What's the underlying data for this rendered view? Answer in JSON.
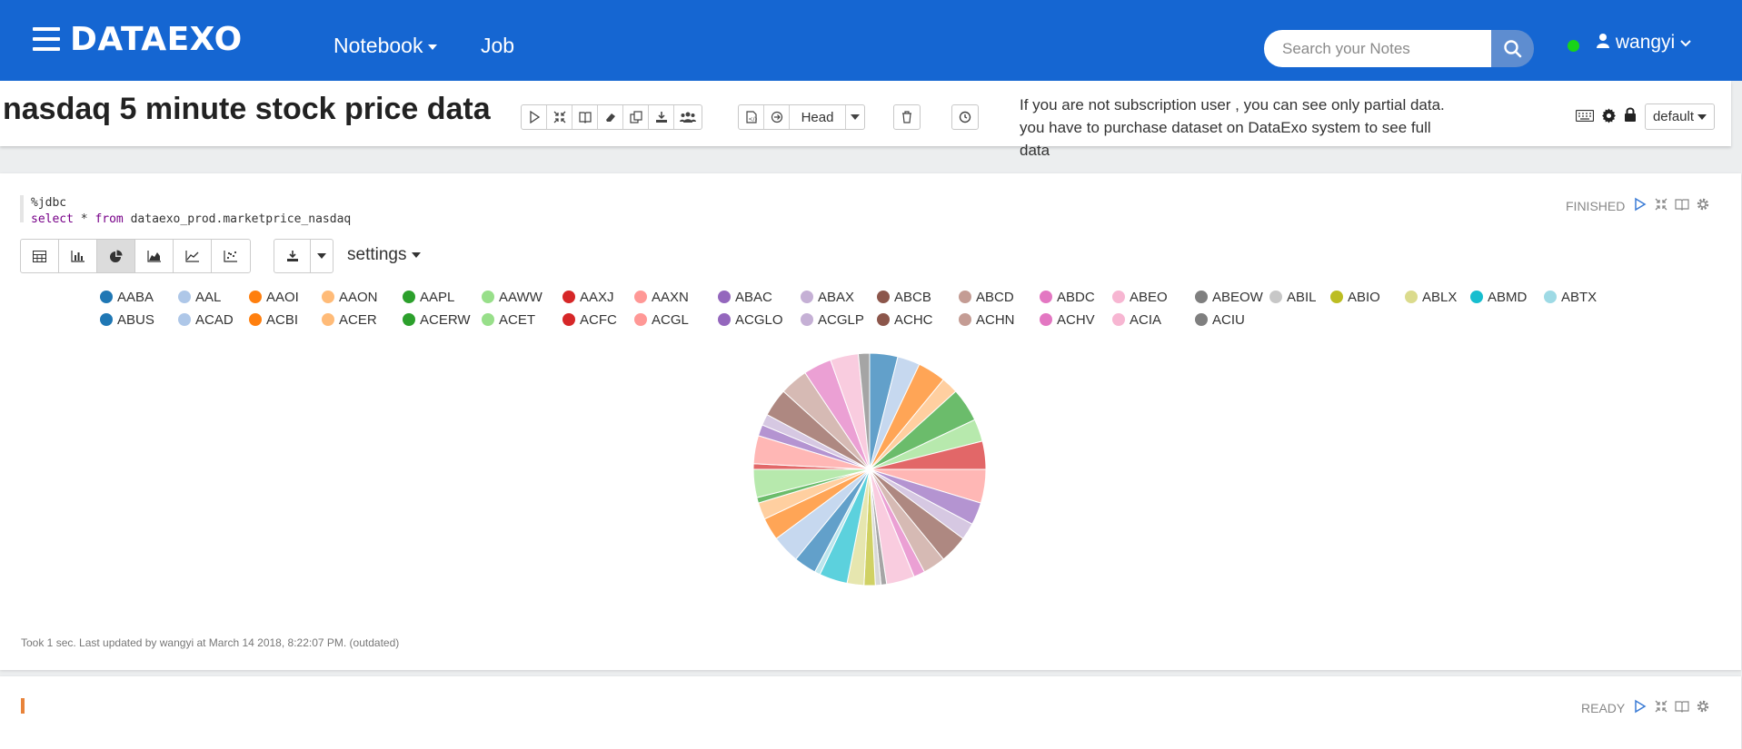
{
  "navbar": {
    "brand": "DATAEXO",
    "nav_notebook": "Notebook",
    "nav_job": "Job",
    "search_placeholder": "Search your Notes",
    "username": "wangyi"
  },
  "note": {
    "title": "nasdaq 5 minute stock price data",
    "head_label": "Head",
    "info_text": "If you are not subscription user , you can see only partial data. you have to purchase dataset on DataExo system to see full data",
    "interpreter_default": "default"
  },
  "paragraph1": {
    "code_line1": "%jdbc",
    "code_kw_select": "select",
    "code_rest": " * ",
    "code_kw_from": "from",
    "code_table": " dataexo_prod.marketprice_nasdaq",
    "status": "FINISHED",
    "settings_label": "settings",
    "footer": "Took 1 sec. Last updated by wangyi at March 14 2018, 8:22:07 PM. (outdated)"
  },
  "paragraph2": {
    "status": "READY"
  },
  "colors": {
    "navbar": "#1566d2",
    "accent_orange": "#e8833a",
    "status_online": "#18d418"
  },
  "chart_data": {
    "type": "pie",
    "categories": [
      "AABA",
      "AAL",
      "AAOI",
      "AAON",
      "AAPL",
      "AAWW",
      "AAXJ",
      "AAXN",
      "ABAC",
      "ABAX",
      "ABCB",
      "ABCD",
      "ABDC",
      "ABEO",
      "ABEOW",
      "ABIL",
      "ABIO",
      "ABLX",
      "ABMD",
      "ABTX",
      "ABUS",
      "ACAD",
      "ACBI",
      "ACER",
      "ACERW",
      "ACET",
      "ACFC",
      "ACGL",
      "ACGLO",
      "ACGLP",
      "ACHC",
      "ACHN",
      "ACHV",
      "ACIA",
      "ACIU"
    ],
    "values": [
      5,
      4,
      5,
      3,
      6,
      4,
      5,
      6,
      4,
      3,
      5,
      4,
      2,
      5,
      1,
      1,
      2,
      3,
      5,
      1,
      4,
      5,
      4,
      3,
      1,
      5,
      1,
      5,
      2,
      2,
      5,
      5,
      5,
      5,
      2
    ],
    "colors": [
      "#1f77b4",
      "#aec7e8",
      "#ff7f0e",
      "#ffbb78",
      "#2ca02c",
      "#98df8a",
      "#d62728",
      "#ff9896",
      "#9467bd",
      "#c5b0d5",
      "#8c564b",
      "#c49c94",
      "#e377c2",
      "#f7b6d2",
      "#7f7f7f",
      "#c7c7c7",
      "#bcbd22",
      "#dbdb8d",
      "#17becf",
      "#9edae5",
      "#1f77b4",
      "#aec7e8",
      "#ff7f0e",
      "#ffbb78",
      "#2ca02c",
      "#98df8a",
      "#d62728",
      "#ff9896",
      "#9467bd",
      "#c5b0d5",
      "#8c564b",
      "#c49c94",
      "#e377c2",
      "#f7b6d2",
      "#7f7f7f"
    ],
    "legend_placement": "top",
    "title": ""
  }
}
